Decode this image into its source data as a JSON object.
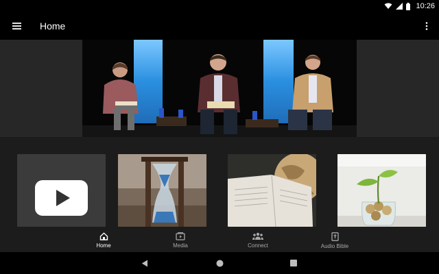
{
  "status_bar": {
    "time": "10:26"
  },
  "app_bar": {
    "title": "Home"
  },
  "hero": {
    "description": "Video still of three speakers seated on stage"
  },
  "thumbnails": [
    {
      "icon": "play-icon"
    },
    {
      "icon": "hourglass"
    },
    {
      "icon": "globe-and-book"
    },
    {
      "icon": "plant-sprout"
    }
  ],
  "bottom_nav": {
    "items": [
      {
        "label": "Home",
        "icon": "home-icon",
        "active": true
      },
      {
        "label": "Media",
        "icon": "media-icon",
        "active": false
      },
      {
        "label": "Connect",
        "icon": "connect-icon",
        "active": false
      },
      {
        "label": "Audio Bible",
        "icon": "bible-icon",
        "active": false
      }
    ]
  },
  "colors": {
    "background": "#000000",
    "surface": "#1c1c1c",
    "stage_light": "#3aa0e8"
  }
}
